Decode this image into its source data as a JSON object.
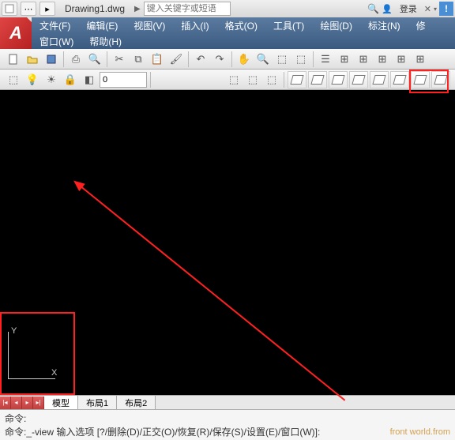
{
  "titlebar": {
    "filename": "Drawing1.dwg",
    "search_placeholder": "键入关键字或短语",
    "login_text": "登录",
    "alert_glyph": "!"
  },
  "logo": {
    "letter": "A"
  },
  "menu": {
    "file": "文件(F)",
    "edit": "编辑(E)",
    "view": "视图(V)",
    "insert": "插入(I)",
    "format": "格式(O)",
    "tools": "工具(T)",
    "draw": "绘图(D)",
    "dimension": "标注(N)",
    "modify": "修",
    "window": "窗口(W)",
    "help": "帮助(H)"
  },
  "layer": {
    "current": "0"
  },
  "ucs": {
    "x": "X",
    "y": "Y"
  },
  "tabs": {
    "model": "模型",
    "layout1": "布局1",
    "layout2": "布局2"
  },
  "command": {
    "label1": "命令:",
    "label2": "命令:",
    "text": " _-view 输入选项 [?/删除(D)/正交(O)/恢复(R)/保存(S)/设置(E)/窗口(W)]:",
    "watermark": "front world.from"
  }
}
